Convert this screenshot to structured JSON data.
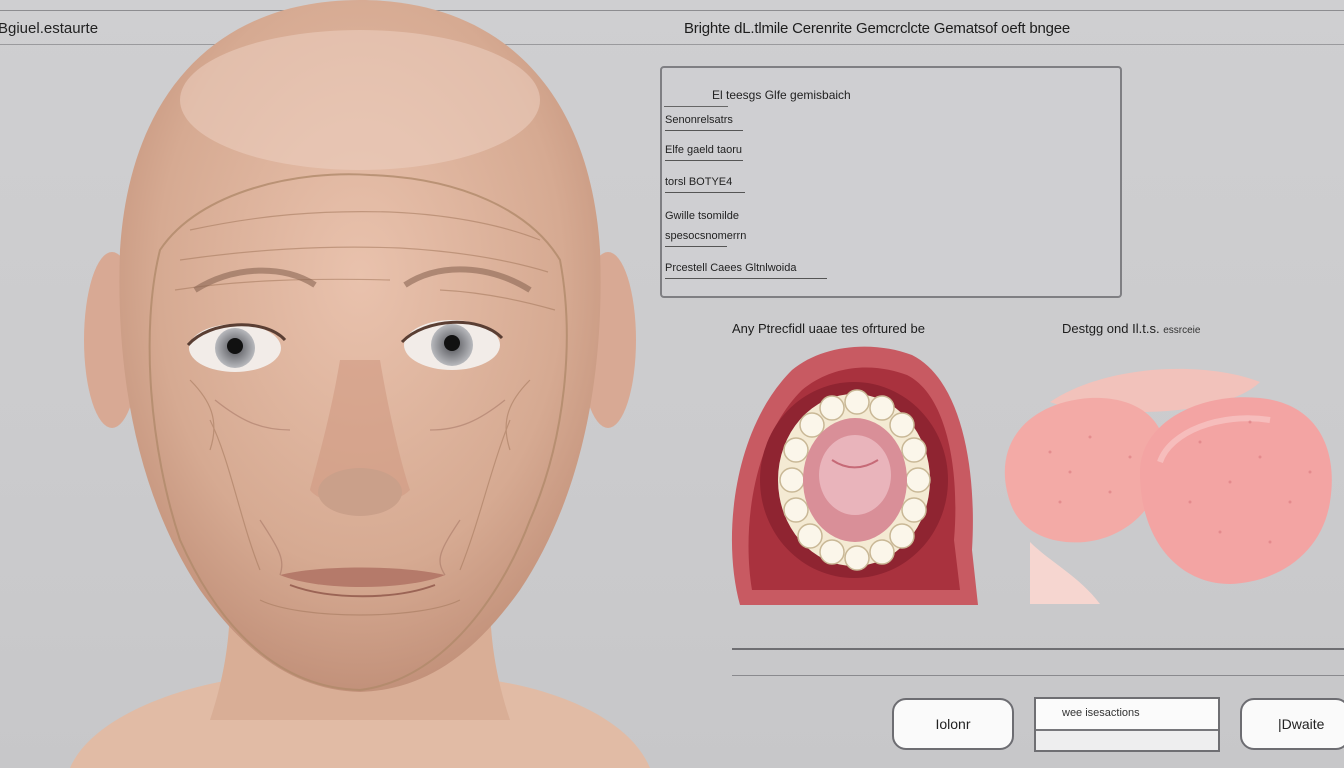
{
  "header": {
    "app_title": "Bgiuel.estaurte",
    "window_title": "Brighte dL.tlmile Cerenrite Gemcrclcte Gematsof oeft bngee"
  },
  "panel": {
    "heading": "El teesgs Glfe gemisbaich",
    "rows": [
      "Senonrelsatrs",
      "Elfe gaeld taoru",
      "torsl BOTYE4",
      "Gwille tsomilde",
      "spesocsnomerrn",
      "Prcestell Caees Gltnlwoida"
    ],
    "badge_text": "BOTYE4"
  },
  "captions": {
    "left": "Any Ptrecfidl uaae tes ofrtured be",
    "right_main": "Destgg ond Il.t.s.",
    "right_small": "essrceie"
  },
  "controls": {
    "left_button": "Iolonr",
    "field_value": "wee isesactions",
    "right_button": "|Dwaite"
  },
  "colors": {
    "background": "#cbcbcd",
    "skin": "#d9ab93",
    "mouth_red": "#c04a55",
    "tongue_pink": "#f2a8a8"
  }
}
